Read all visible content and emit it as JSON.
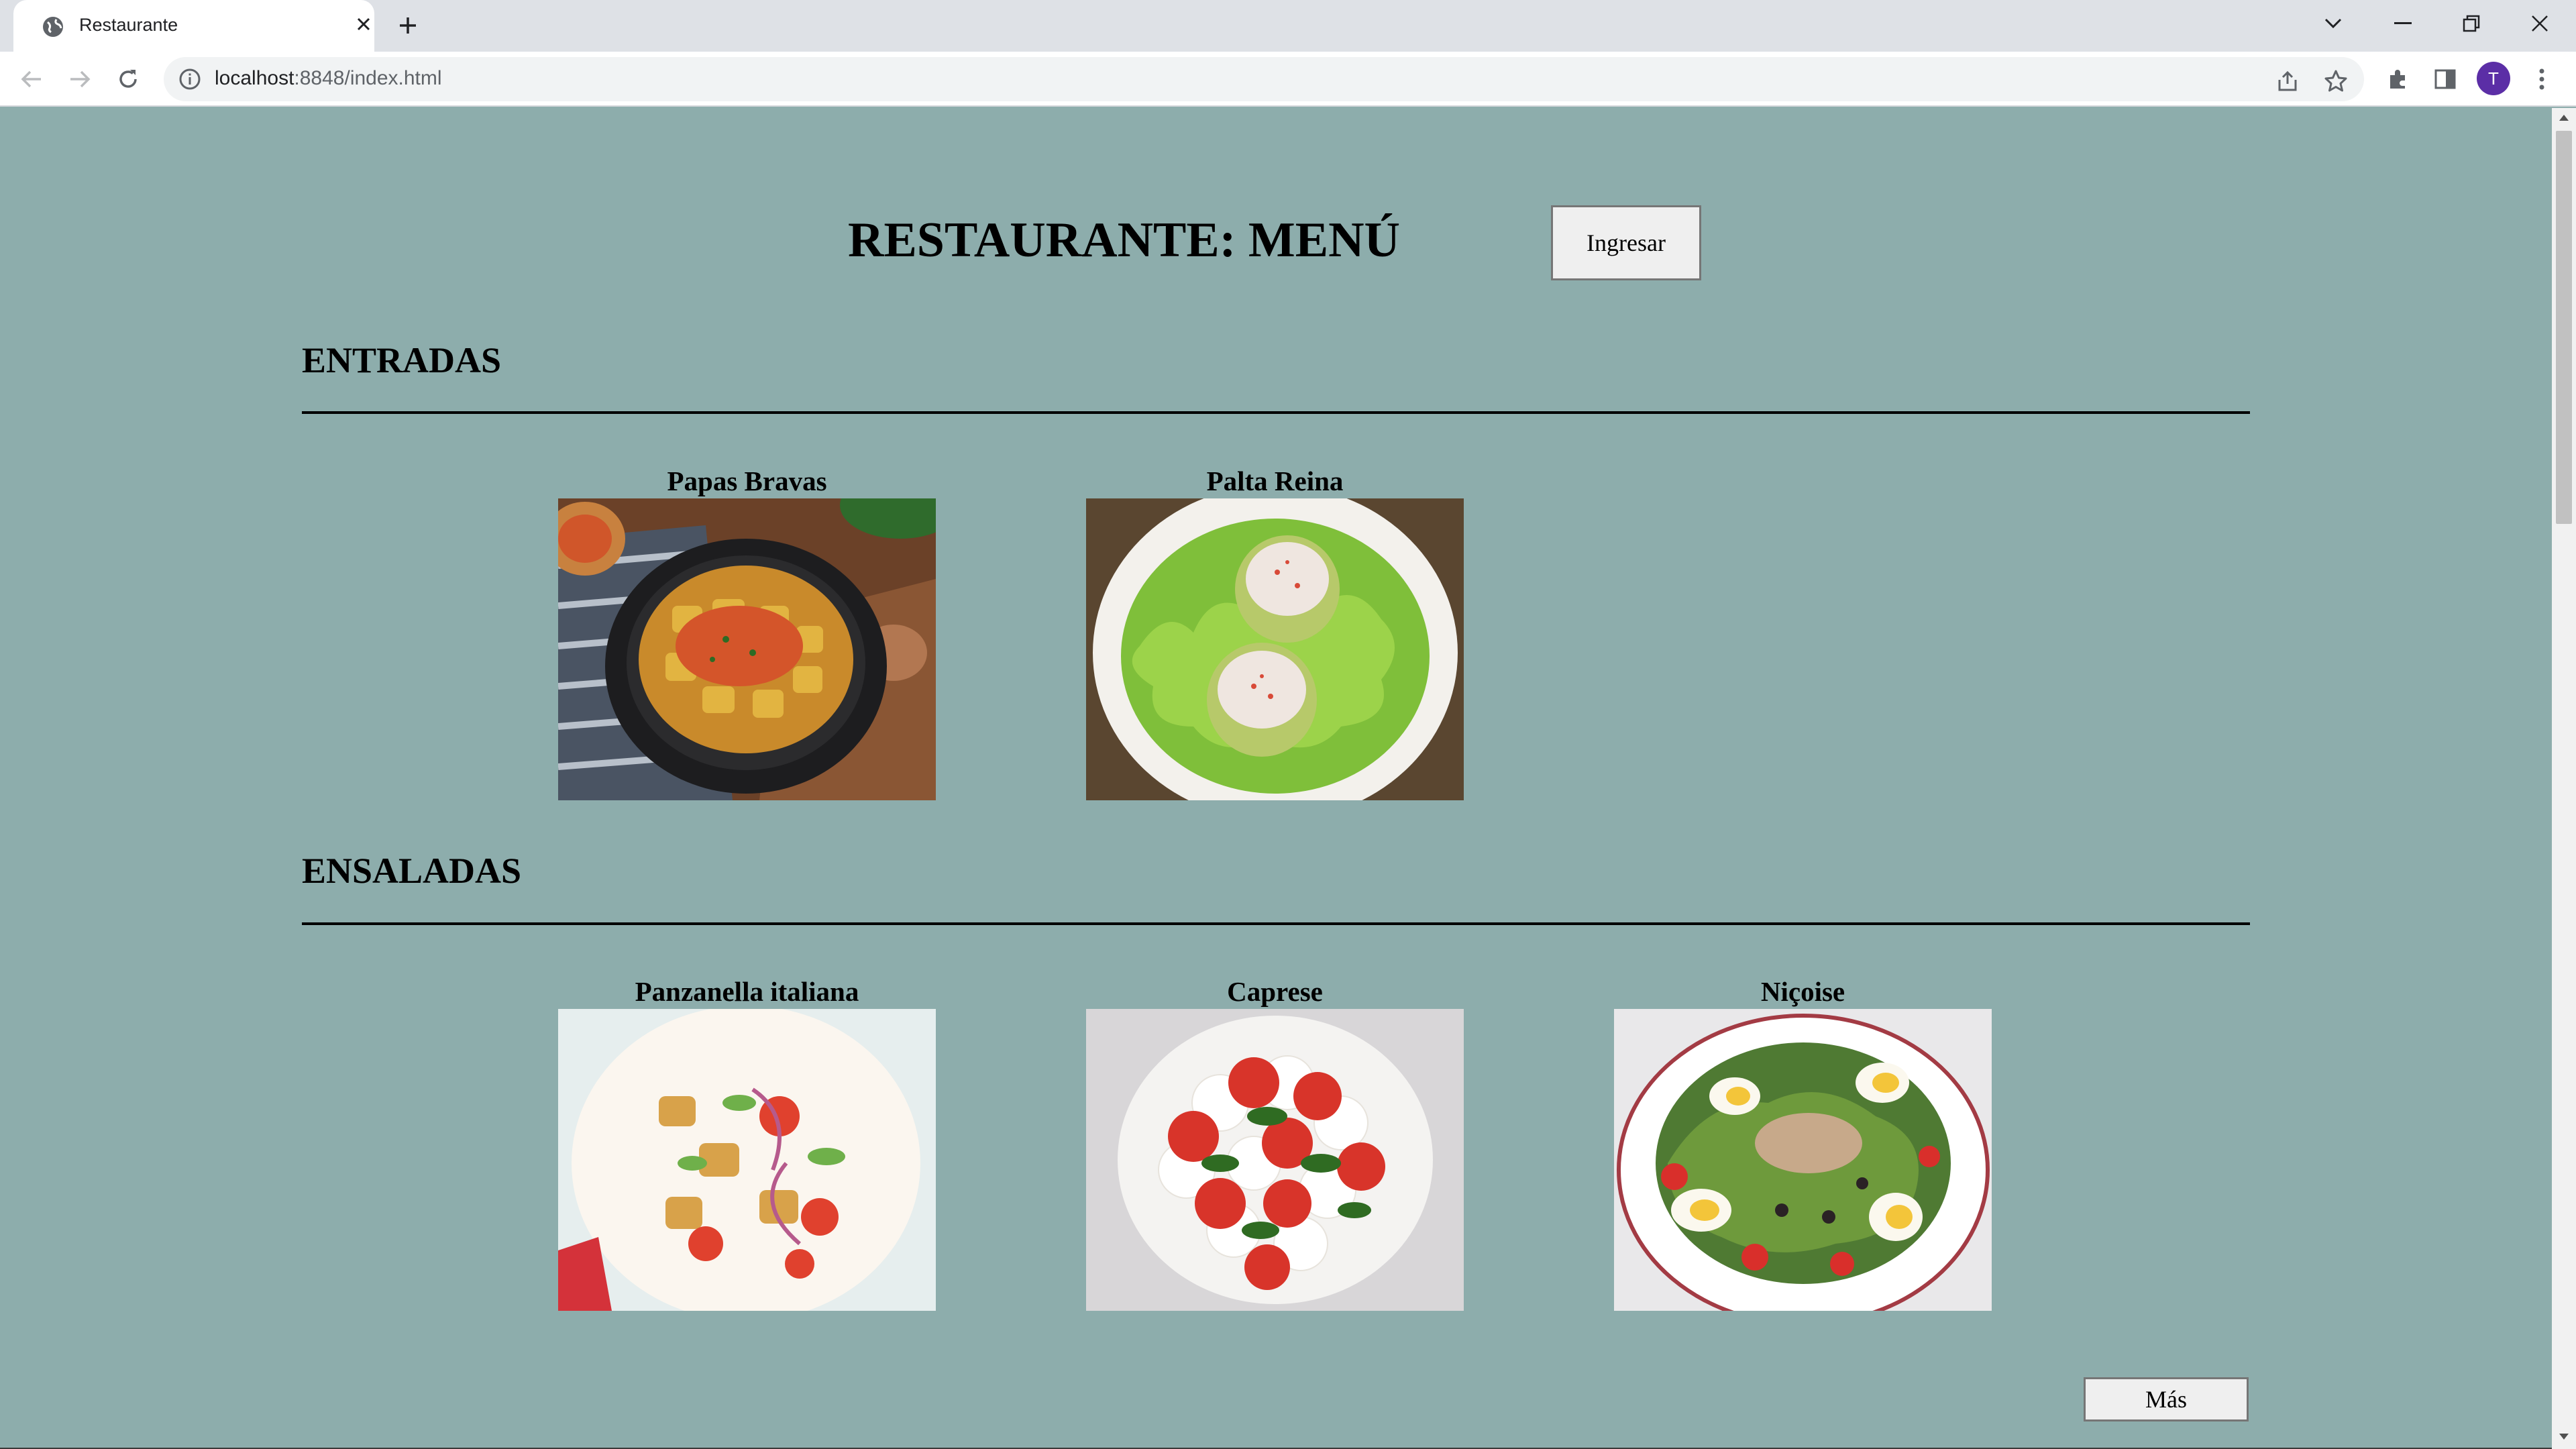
{
  "browser": {
    "tab_title": "Restaurante",
    "url_host": "localhost",
    "url_path": ":8848/index.html",
    "avatar_letter": "T"
  },
  "page": {
    "title": "RESTAURANTE: MENÚ",
    "login_button": "Ingresar",
    "more_button": "Más",
    "sections": [
      {
        "title": "ENTRADAS",
        "dishes": [
          {
            "name": "Papas Bravas"
          },
          {
            "name": "Palta Reina"
          }
        ]
      },
      {
        "title": "ENSALADAS",
        "dishes": [
          {
            "name": "Panzanella italiana"
          },
          {
            "name": "Caprese"
          },
          {
            "name": "Niçoise"
          }
        ]
      }
    ]
  },
  "colors": {
    "page_background": "#8dadac",
    "button_background": "#efefef",
    "avatar": "#5b2ea6"
  }
}
